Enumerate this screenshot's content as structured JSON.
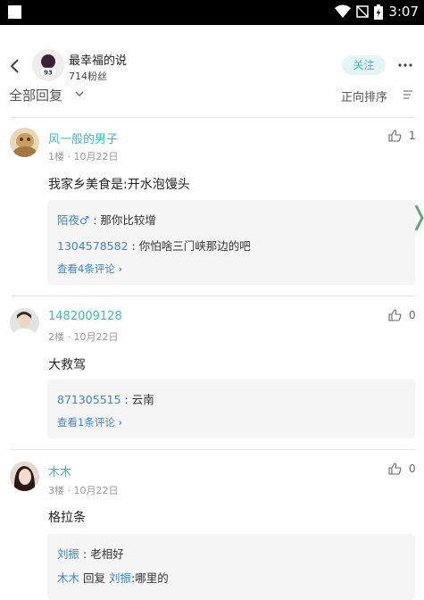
{
  "status_bar": {
    "time": "3:07"
  },
  "header": {
    "avatar_text": "93",
    "name": "最幸福的说",
    "fans": "714粉丝",
    "follow_label": "关注"
  },
  "toolbar": {
    "sort_all": "全部回复",
    "sort_order": "正向排序"
  },
  "comments": [
    {
      "name": "风一般的男子",
      "floor": "1楼",
      "date": "10月22日",
      "likes": "1",
      "text": "我家乡美食是:开水泡馒头",
      "replies": [
        {
          "user": "陌夜♂",
          "sep": " : ",
          "text": "那你比较增"
        },
        {
          "user": "1304578582",
          "sep": " : ",
          "text": "你怕啥三门峡那边的吧"
        }
      ],
      "more": "查看4条评论"
    },
    {
      "name": "1482009128",
      "floor": "2楼",
      "date": "10月22日",
      "likes": "0",
      "text": "大救驾",
      "replies": [
        {
          "user": "871305515",
          "sep": " : ",
          "text": "云南"
        }
      ],
      "more": "查看1条评论"
    },
    {
      "name": "木木",
      "floor": "3楼",
      "date": "10月22日",
      "likes": "0",
      "text": "格拉条",
      "replies": [
        {
          "user": "刘振",
          "sep": " : ",
          "text": "老相好"
        },
        {
          "user": "木木",
          "mid": " 回复 ",
          "user2": "刘振",
          "sep": ":",
          "text": "哪里的"
        }
      ]
    }
  ],
  "colors": {
    "accent": "#3cb9c4",
    "link": "#3d86c8"
  },
  "icons": [
    "back-arrow-icon",
    "more-dots-icon",
    "chevron-down-icon",
    "sort-lines-icon",
    "thumb-up-icon",
    "chevron-right-icon"
  ]
}
